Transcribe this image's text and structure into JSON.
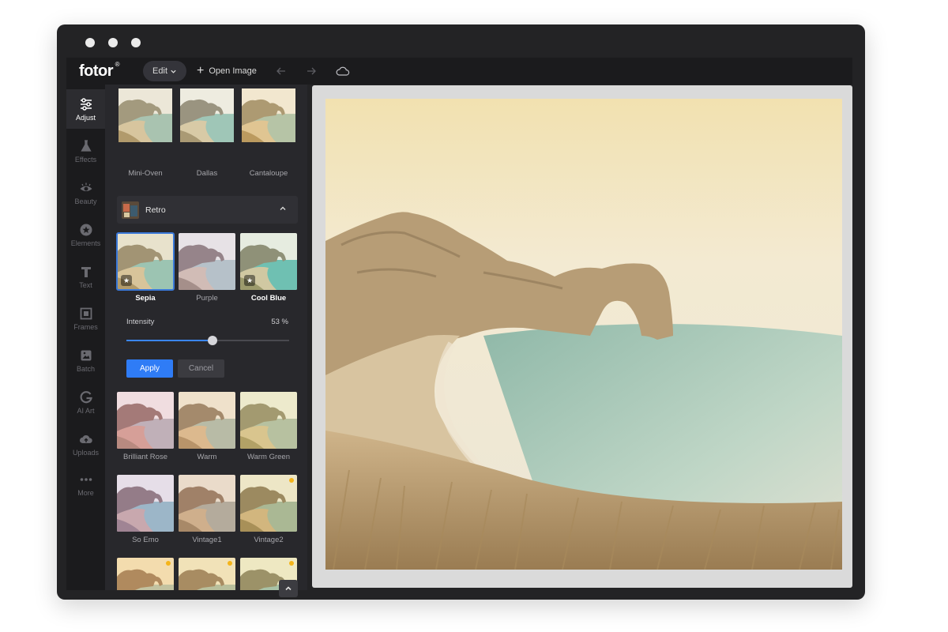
{
  "window": {
    "title": "fotor"
  },
  "topbar": {
    "logo": "fotor",
    "logo_mark": "®",
    "edit_label": "Edit",
    "open_image_label": "Open Image"
  },
  "sidebar": {
    "items": [
      {
        "label": "Adjust",
        "icon": "sliders-icon",
        "active": true
      },
      {
        "label": "Effects",
        "icon": "flask-icon"
      },
      {
        "label": "Beauty",
        "icon": "eye-icon"
      },
      {
        "label": "Elements",
        "icon": "star-circle-icon"
      },
      {
        "label": "Text",
        "icon": "text-icon"
      },
      {
        "label": "Frames",
        "icon": "frame-icon"
      },
      {
        "label": "Batch",
        "icon": "batch-icon"
      },
      {
        "label": "AI Art",
        "icon": "ai-art-icon"
      },
      {
        "label": "Uploads",
        "icon": "cloud-upload-icon"
      },
      {
        "label": "More",
        "icon": "more-dots-icon"
      }
    ]
  },
  "panel": {
    "top_row": [
      "Mini-Oven",
      "Dallas",
      "Cantaloupe"
    ],
    "section_title": "Retro",
    "retro_row": [
      {
        "label": "Sepia",
        "selected": true,
        "starred": true
      },
      {
        "label": "Purple"
      },
      {
        "label": "Cool Blue",
        "starred": true,
        "bold": true
      }
    ],
    "intensity_label": "Intensity",
    "intensity_value": "53 %",
    "intensity": 0.53,
    "apply_label": "Apply",
    "cancel_label": "Cancel",
    "row2": [
      "Brilliant Rose",
      "Warm",
      "Warm Green"
    ],
    "row3": [
      "So Emo",
      "Vintage1",
      "Vintage2"
    ]
  },
  "colors": {
    "accent": "#2f7cf6",
    "premium": "#f4b41a"
  }
}
